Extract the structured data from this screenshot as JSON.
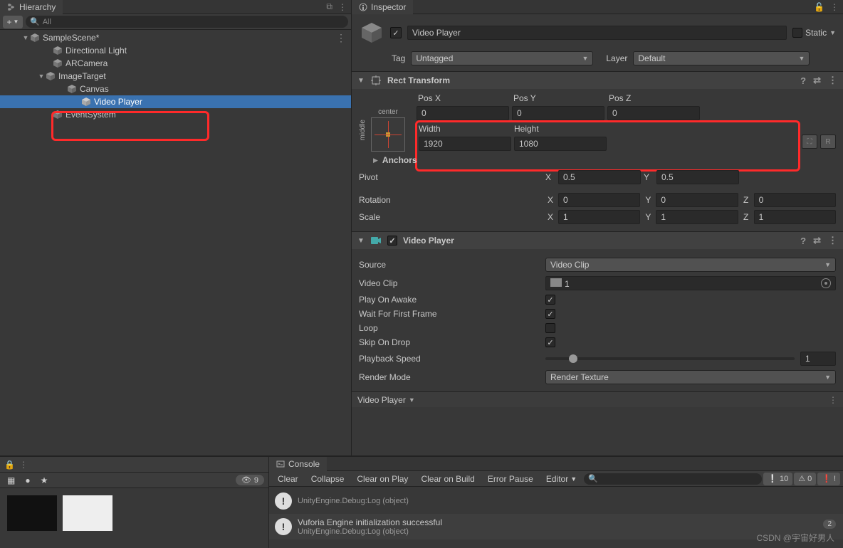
{
  "hierarchy": {
    "tab_label": "Hierarchy",
    "search_placeholder": "All",
    "scene": "SampleScene*",
    "items": {
      "directional_light": "Directional Light",
      "ar_camera": "ARCamera",
      "image_target": "ImageTarget",
      "canvas": "Canvas",
      "video_player": "Video Player",
      "event_system": "EventSystem"
    }
  },
  "inspector": {
    "tab_label": "Inspector",
    "object_name": "Video Player",
    "static_label": "Static",
    "tag_label": "Tag",
    "tag_value": "Untagged",
    "layer_label": "Layer",
    "layer_value": "Default"
  },
  "rect_transform": {
    "title": "Rect Transform",
    "anchor_h": "center",
    "anchor_v": "middle",
    "posx_label": "Pos X",
    "posy_label": "Pos Y",
    "posz_label": "Pos Z",
    "posx": "0",
    "posy": "0",
    "posz": "0",
    "width_label": "Width",
    "height_label": "Height",
    "width": "1920",
    "height": "1080",
    "anchors_label": "Anchors",
    "pivot_label": "Pivot",
    "pivot_x": "0.5",
    "pivot_y": "0.5",
    "rotation_label": "Rotation",
    "rot_x": "0",
    "rot_y": "0",
    "rot_z": "0",
    "scale_label": "Scale",
    "scale_x": "1",
    "scale_y": "1",
    "scale_z": "1",
    "blueprint_btn": "R"
  },
  "video_player": {
    "title": "Video Player",
    "source_label": "Source",
    "source_value": "Video Clip",
    "clip_label": "Video Clip",
    "clip_value": "1",
    "play_on_awake_label": "Play On Awake",
    "wait_first_frame_label": "Wait For First Frame",
    "loop_label": "Loop",
    "skip_on_drop_label": "Skip On Drop",
    "playback_speed_label": "Playback Speed",
    "playback_speed": "1",
    "render_mode_label": "Render Mode",
    "render_mode_value": "Render Texture",
    "bottom_tab": "Video Player"
  },
  "console": {
    "tab_label": "Console",
    "clear": "Clear",
    "collapse": "Collapse",
    "clear_play": "Clear on Play",
    "clear_build": "Clear on Build",
    "error_pause": "Error Pause",
    "editor": "Editor",
    "info_count": "10",
    "warn_count": "0",
    "err_count": "!",
    "hidden_count": "9",
    "hidden_badge": "2",
    "entries": [
      {
        "msg": "",
        "src": "UnityEngine.Debug:Log (object)"
      },
      {
        "msg": "Vuforia Engine initialization successful",
        "src": "UnityEngine.Debug:Log (object)"
      }
    ]
  },
  "watermark": "CSDN @宇宙好男人"
}
